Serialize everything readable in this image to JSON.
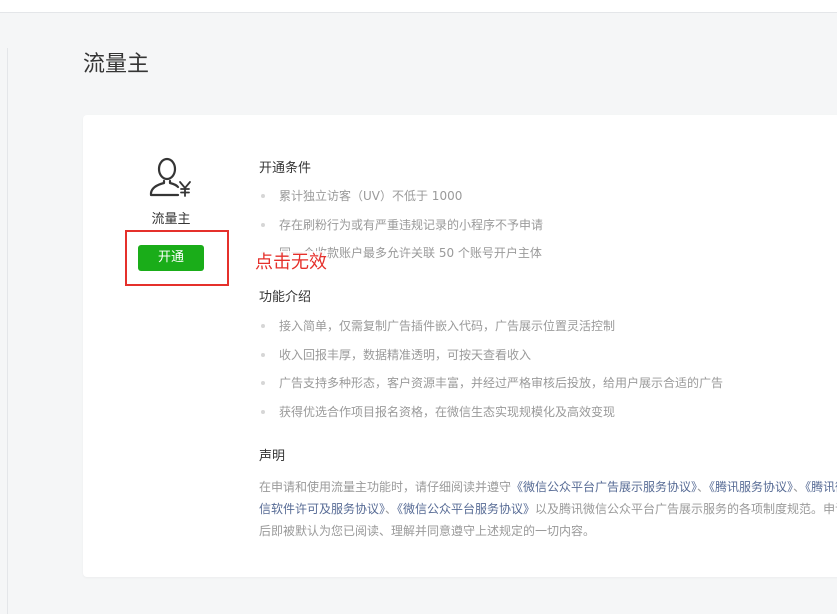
{
  "page": {
    "title": "流量主"
  },
  "product": {
    "icon": "user-yen-icon",
    "name": "流量主",
    "open_button_label": "开通",
    "annotation": "点击无效"
  },
  "conditions": {
    "heading": "开通条件",
    "items": [
      "累计独立访客（UV）不低于 1000",
      "存在刷粉行为或有严重违规记录的小程序不予申请",
      "同一个收款账户最多允许关联 50 个账号开户主体"
    ]
  },
  "features": {
    "heading": "功能介绍",
    "items": [
      "接入简单，仅需复制广告插件嵌入代码，广告展示位置灵活控制",
      "收入回报丰厚，数据精准透明，可按天查看收入",
      "广告支持多种形态，客户资源丰富，并经过严格审核后投放，给用户展示合适的广告",
      "获得优选合作项目报名资格，在微信生态实现规模化及高效变现"
    ]
  },
  "statement": {
    "heading": "声明",
    "text_1": "在申请和使用流量主功能时，请仔细阅读并遵守",
    "link_1": "《微信公众平台广告展示服务协议》",
    "sep_1": "、",
    "link_2": "《腾讯服务协议》",
    "sep_2": "、",
    "link_3": "《腾讯微信软件许可及服务协议》",
    "sep_3": "、",
    "link_4": "《微信公众平台服务协议》",
    "text_2": "以及腾讯微信公众平台广告展示服务的各项制度规范。",
    "text_3": "申请后即被默认为您已阅读、理解并同意遵守上述规定的一切内容。"
  },
  "colors": {
    "accent_green": "#1aad19",
    "annotation_red": "#e5302b",
    "link_blue": "#576b95"
  }
}
